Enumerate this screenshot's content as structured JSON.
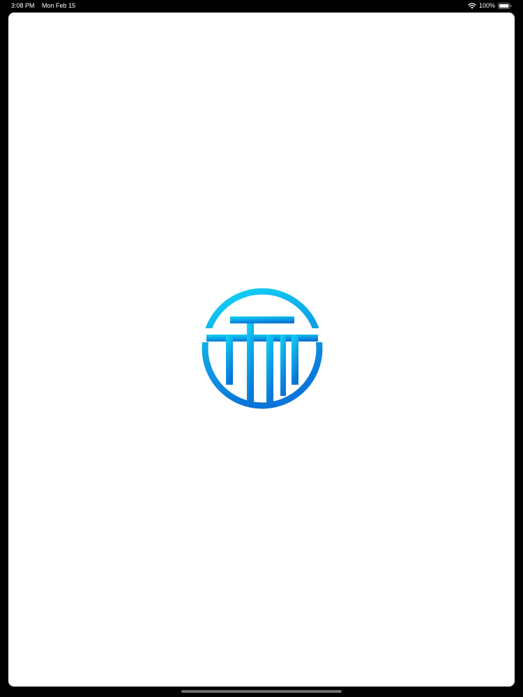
{
  "status_bar": {
    "time": "3:08 PM",
    "date": "Mon Feb 15",
    "battery_percent": "100%",
    "battery_level": 1.0,
    "wifi_icon": "wifi-icon",
    "battery_icon": "battery-icon"
  },
  "splash": {
    "logo_icon": "tt-circle-logo-icon",
    "logo_gradient": [
      "#12d6f6",
      "#0a74d8"
    ]
  },
  "colors": {
    "screen_background": "#ffffff",
    "frame": "#000000",
    "home_indicator": "#6d6d6d"
  }
}
